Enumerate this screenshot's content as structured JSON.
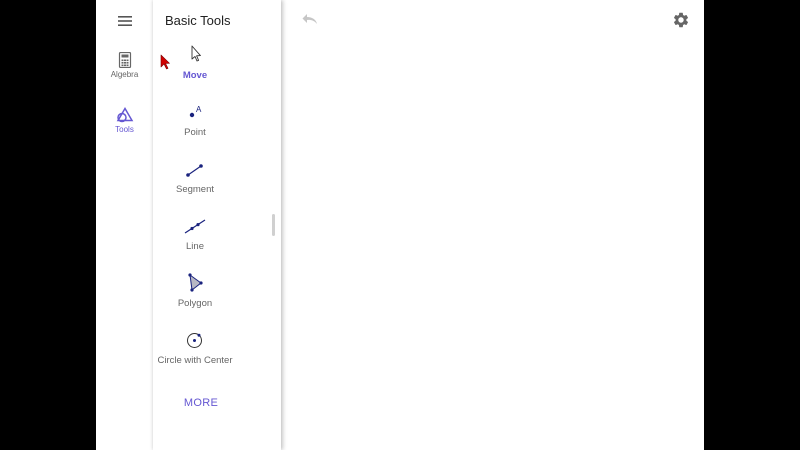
{
  "rail": {
    "items": [
      {
        "label": "Algebra",
        "icon": "calculator-icon"
      },
      {
        "label": "Tools",
        "icon": "tools-shapes-icon"
      }
    ]
  },
  "panel": {
    "title": "Basic Tools",
    "tools": [
      {
        "label": "Move",
        "icon": "move-arrow-icon"
      },
      {
        "label": "Point",
        "icon": "point-icon"
      },
      {
        "label": "Segment",
        "icon": "segment-icon"
      },
      {
        "label": "Line",
        "icon": "line-icon"
      },
      {
        "label": "Polygon",
        "icon": "polygon-icon"
      },
      {
        "label": "Circle with Center",
        "icon": "circle-center-icon"
      }
    ],
    "more_label": "MORE"
  },
  "toolbar": {
    "undo_icon": "undo-icon",
    "settings_icon": "gear-icon"
  },
  "colors": {
    "accent": "#6557d2",
    "tool_icon": "#1a237e",
    "label_gray": "#666666",
    "cursor_red": "#d10000"
  }
}
